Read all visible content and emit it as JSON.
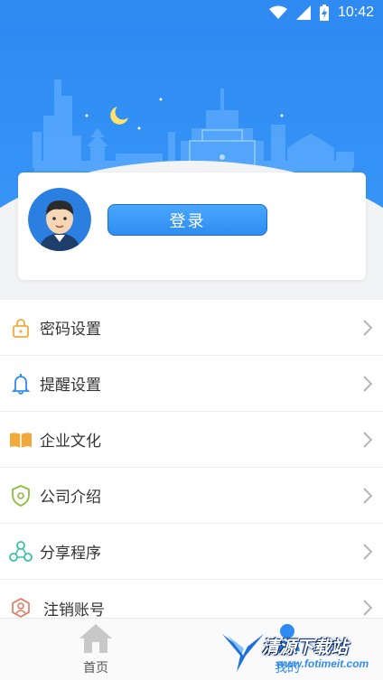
{
  "status_bar": {
    "time": "10:42",
    "icons": [
      "wifi-icon",
      "signal-icon",
      "battery-charging-icon"
    ]
  },
  "header": {
    "illustration": "city-skyline-with-moon"
  },
  "profile": {
    "login_label": "登录",
    "avatar_icon": "cartoon-user-avatar"
  },
  "menu": {
    "items": [
      {
        "label": "密码设置",
        "icon": "lock-icon"
      },
      {
        "label": "提醒设置",
        "icon": "bell-icon"
      },
      {
        "label": "企业文化",
        "icon": "book-icon"
      },
      {
        "label": "公司介绍",
        "icon": "shield-icon"
      },
      {
        "label": "分享程序",
        "icon": "share-icon"
      },
      {
        "label": "注销账号",
        "icon": "account-cancel-icon"
      }
    ]
  },
  "tabbar": {
    "home_label": "首页",
    "mine_label": "我的"
  },
  "watermark": {
    "title": "清源下载站",
    "url": "www.fotimeit.com"
  },
  "colors": {
    "primary": "#2f8bf2",
    "background": "#f2f3f5",
    "text": "#333333"
  }
}
